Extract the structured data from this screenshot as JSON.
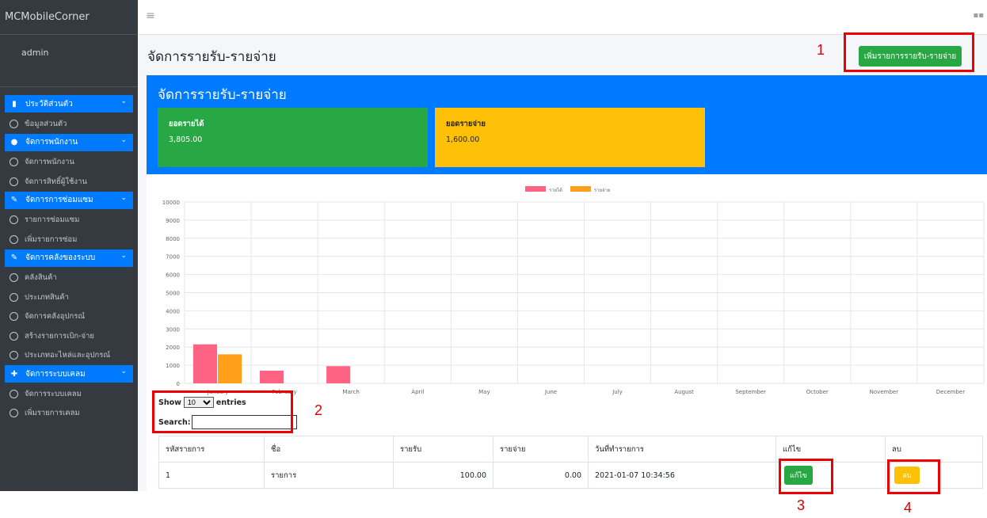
{
  "sidebar": {
    "brand": "MCMobileCorner",
    "user": "admin",
    "groups": [
      {
        "label": "ประวัติส่วนตัว",
        "icon": "id-card-icon",
        "items": [
          "ข้อมูลส่วนตัว"
        ]
      },
      {
        "label": "จัดการพนักงาน",
        "icon": "users-icon",
        "items": [
          "จัดการพนักงาน",
          "จัดการสิทธิ์ผู้ใช้งาน"
        ]
      },
      {
        "label": "จัดการการซ่อมแซม",
        "icon": "wrench-icon",
        "items": [
          "รายการซ่อมแซม",
          "เพิ่มรายการซ่อม"
        ]
      },
      {
        "label": "จัดการคลังของระบบ",
        "icon": "wrench-icon",
        "items": [
          "คลังสินค้า",
          "ประเภทสินค้า",
          "จัดการคลังอุปกรณ์",
          "สร้างรายการเบิก-จ่าย",
          "ประเภทอะไหล่และอุปกรณ์"
        ]
      },
      {
        "label": "จัดการระบบเคลม",
        "icon": "puzzle-icon",
        "items": [
          "จัดการระบบเคลม",
          "เพิ่มรายการเคลม"
        ]
      }
    ]
  },
  "topbar": {
    "menu_icon": "hamburger-icon",
    "apps_icon": "grid-icon"
  },
  "page": {
    "title": "จัดการรายรับ-รายจ่าย",
    "add_button": "เพิ่มรายการรายรับ-รายจ่าย"
  },
  "card": {
    "title": "จัดการรายรับ-รายจ่าย",
    "income_label": "ยอดรายได้",
    "income_value": "3,805.00",
    "expense_label": "ยอดรายจ่าย",
    "expense_value": "1,600.00",
    "income_color": "#28a745",
    "expense_color": "#ffc107",
    "header_color": "#007bff"
  },
  "chart_data": {
    "type": "bar",
    "categories": [
      "January",
      "February",
      "March",
      "April",
      "May",
      "June",
      "July",
      "August",
      "September",
      "October",
      "November",
      "December"
    ],
    "series": [
      {
        "name": "รายได้",
        "color": "#ff6384",
        "values": [
          2150,
          700,
          950,
          0,
          0,
          0,
          0,
          0,
          0,
          0,
          0,
          0
        ]
      },
      {
        "name": "รายจ่าย",
        "color": "#ff9f1a",
        "values": [
          1600,
          0,
          0,
          0,
          0,
          0,
          0,
          0,
          0,
          0,
          0,
          0
        ]
      }
    ],
    "yticks": [
      "0",
      "1000",
      "2000",
      "3000",
      "4000",
      "5000",
      "6000",
      "7000",
      "8000",
      "9000",
      "10000"
    ],
    "ylim": [
      0,
      10000
    ],
    "legend": "top-center",
    "grid": true
  },
  "table_controls": {
    "show_prefix": "Show",
    "entries_value": "10",
    "show_suffix": "entries",
    "search_label": "Search:"
  },
  "table": {
    "headers": [
      "รหัสรายการ",
      "ชื่อ",
      "รายรับ",
      "รายจ่าย",
      "วันที่ทำรายการ",
      "แก้ไข",
      "ลบ"
    ],
    "rows": [
      {
        "id": "1",
        "name": "รายการ",
        "income": "100.00",
        "expense": "0.00",
        "date": "2021-01-07 10:34:56",
        "edit": "แก้ไข",
        "delete": "ลบ"
      }
    ]
  },
  "annotations": [
    "1",
    "2",
    "3",
    "4"
  ]
}
